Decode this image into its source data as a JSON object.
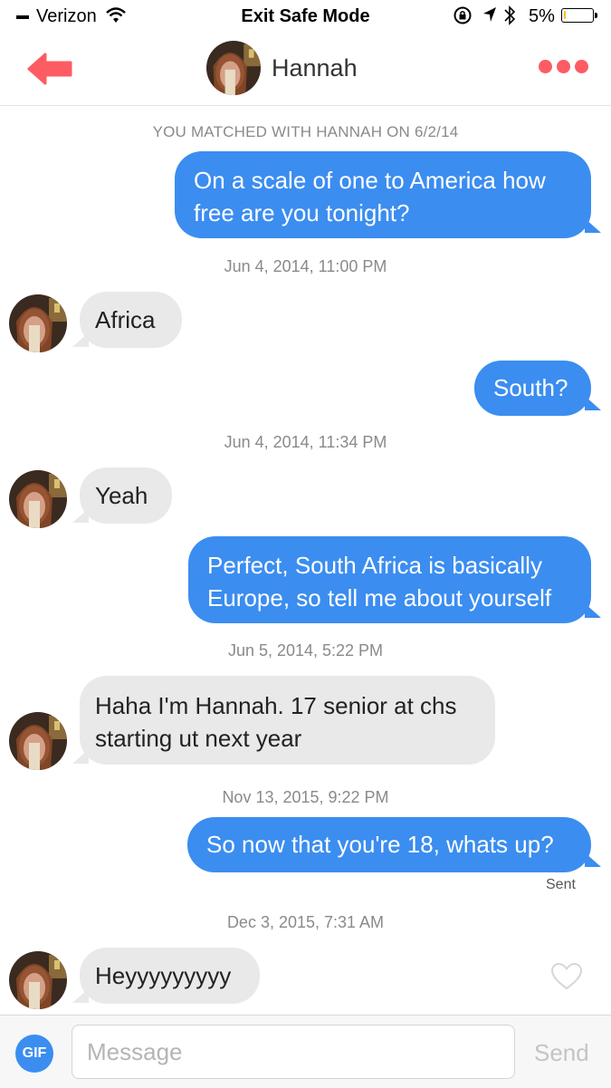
{
  "status_bar": {
    "carrier": "Verizon",
    "mode_title": "Exit Safe Mode",
    "battery_text": "5%",
    "battery_level": 0.05
  },
  "header": {
    "contact_name": "Hannah"
  },
  "match_notice": "YOU MATCHED WITH HANNAH ON 6/2/14",
  "messages": [
    {
      "from": "me",
      "lines": [
        "On a scale of one to America how",
        "free are you tonight?"
      ]
    },
    {
      "timestamp": "Jun 4, 2014, 11:00 PM"
    },
    {
      "from": "hannah",
      "lines": [
        "Africa"
      ]
    },
    {
      "from": "me",
      "lines": [
        "South?"
      ]
    },
    {
      "timestamp": "Jun 4, 2014, 11:34 PM"
    },
    {
      "from": "hannah",
      "lines": [
        "Yeah"
      ]
    },
    {
      "from": "me",
      "lines": [
        "Perfect, South Africa is basically",
        "Europe, so tell me about yourself"
      ]
    },
    {
      "timestamp": "Jun 5, 2014, 5:22 PM"
    },
    {
      "from": "hannah",
      "lines": [
        "Haha I'm Hannah. 17 senior at chs",
        "starting ut next year"
      ]
    },
    {
      "timestamp": "Nov 13, 2015, 9:22 PM"
    },
    {
      "from": "me",
      "lines": [
        "So now that you're 18, whats up?"
      ]
    },
    {
      "timestamp": "Dec 3, 2015, 7:31 AM"
    },
    {
      "from": "hannah",
      "lines": [
        "Heyyyyyyyyy"
      ]
    }
  ],
  "sent_label": "Sent",
  "compose": {
    "gif_label": "GIF",
    "placeholder": "Message",
    "send_label": "Send"
  },
  "colors": {
    "sent_bubble": "#3b8df0",
    "received_bubble": "#e9e9e9",
    "accent": "#fd5c63"
  }
}
